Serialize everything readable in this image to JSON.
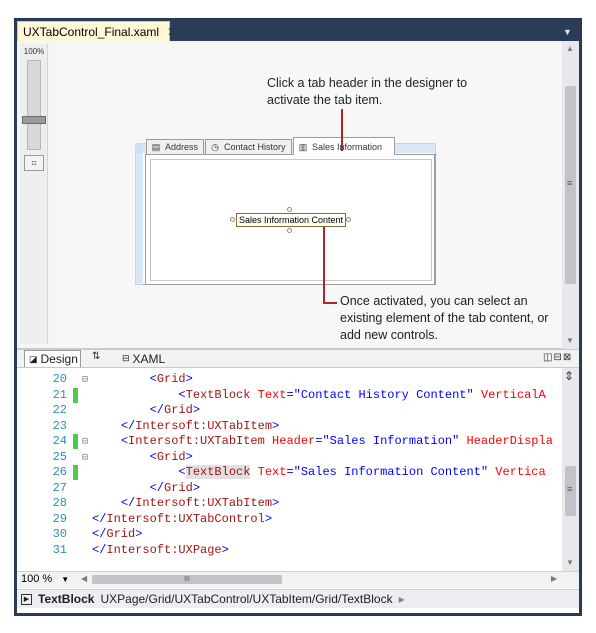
{
  "document_tab": {
    "title": "UXTabControl_Final.xaml",
    "close_glyph": "✕"
  },
  "designer": {
    "zoom_slider_label": "100%",
    "tabs": [
      {
        "label": "Address",
        "icon": "address-icon"
      },
      {
        "label": "Contact History",
        "icon": "contact-history-icon"
      },
      {
        "label": "Sales Information",
        "icon": "sales-icon"
      }
    ],
    "selected_content": "Sales Information Content",
    "callout_top": "Click a tab header in the designer to activate the tab item.",
    "callout_bottom": "Once activated, you can select an existing element of the tab content, or add new controls."
  },
  "view_tabs": {
    "design_label": "Design",
    "swap_glyph": "⇅",
    "xaml_label": "XAML"
  },
  "code_lines": [
    {
      "num": "20",
      "change": "",
      "fold": "⊟",
      "indent": "        ",
      "tokens": [
        [
          "br",
          "<"
        ],
        [
          "tag",
          "Grid"
        ],
        [
          "br",
          ">"
        ]
      ]
    },
    {
      "num": "21",
      "change": "#4ec94e",
      "fold": "",
      "indent": "            ",
      "tokens": [
        [
          "br",
          "<"
        ],
        [
          "tag",
          "TextBlock"
        ],
        [
          "attr",
          " Text"
        ],
        [
          "br",
          "=\""
        ],
        [
          "val",
          "Contact History Content"
        ],
        [
          "br",
          "\""
        ],
        [
          "attr",
          " VerticalA"
        ]
      ]
    },
    {
      "num": "22",
      "change": "",
      "fold": "",
      "indent": "        ",
      "tokens": [
        [
          "br",
          "</"
        ],
        [
          "tag",
          "Grid"
        ],
        [
          "br",
          ">"
        ]
      ]
    },
    {
      "num": "23",
      "change": "",
      "fold": "",
      "indent": "    ",
      "tokens": [
        [
          "br",
          "</"
        ],
        [
          "tag",
          "Intersoft:UXTabItem"
        ],
        [
          "br",
          ">"
        ]
      ]
    },
    {
      "num": "24",
      "change": "#4ec94e",
      "fold": "⊟",
      "indent": "    ",
      "tokens": [
        [
          "br",
          "<"
        ],
        [
          "tag",
          "Intersoft:UXTabItem"
        ],
        [
          "attr",
          " Header"
        ],
        [
          "br",
          "=\""
        ],
        [
          "val",
          "Sales Information"
        ],
        [
          "br",
          "\""
        ],
        [
          "attr",
          " HeaderDispla"
        ]
      ]
    },
    {
      "num": "25",
      "change": "",
      "fold": "⊟",
      "indent": "        ",
      "tokens": [
        [
          "br",
          "<"
        ],
        [
          "tag",
          "Grid"
        ],
        [
          "br",
          ">"
        ]
      ]
    },
    {
      "num": "26",
      "change": "#4ec94e",
      "fold": "",
      "indent": "            ",
      "tokens": [
        [
          "br",
          "<"
        ],
        [
          "hl",
          "TextBlock"
        ],
        [
          "attr",
          " Text"
        ],
        [
          "br",
          "=\""
        ],
        [
          "val",
          "Sales Information Content"
        ],
        [
          "br",
          "\""
        ],
        [
          "attr",
          " Vertica"
        ]
      ]
    },
    {
      "num": "27",
      "change": "",
      "fold": "",
      "indent": "        ",
      "tokens": [
        [
          "br",
          "</"
        ],
        [
          "tag",
          "Grid"
        ],
        [
          "br",
          ">"
        ]
      ]
    },
    {
      "num": "28",
      "change": "",
      "fold": "",
      "indent": "    ",
      "tokens": [
        [
          "br",
          "</"
        ],
        [
          "tag",
          "Intersoft:UXTabItem"
        ],
        [
          "br",
          ">"
        ]
      ]
    },
    {
      "num": "29",
      "change": "",
      "fold": "",
      "indent": "",
      "tokens": [
        [
          "br",
          "</"
        ],
        [
          "tag",
          "Intersoft:UXTabControl"
        ],
        [
          "br",
          ">"
        ]
      ]
    },
    {
      "num": "30",
      "change": "",
      "fold": "",
      "indent": "",
      "tokens": [
        [
          "br",
          "</"
        ],
        [
          "tag",
          "Grid"
        ],
        [
          "br",
          ">"
        ]
      ]
    },
    {
      "num": "31",
      "change": "",
      "fold": "",
      "indent": "",
      "tokens": [
        [
          "br",
          "</"
        ],
        [
          "tag",
          "Intersoft:UXPage"
        ],
        [
          "br",
          ">"
        ]
      ]
    }
  ],
  "editor_footer": {
    "zoom": "100 %",
    "scroll_grip": "III"
  },
  "statusbar": {
    "element": "TextBlock",
    "path": "UXPage/Grid/UXTabControl/UXTabItem/Grid/TextBlock"
  },
  "colors": {
    "window_chrome": "#2b3c59",
    "active_tab": "#fff8d6",
    "callout_line": "#b4242b",
    "change_marker": "#4ec94e"
  }
}
